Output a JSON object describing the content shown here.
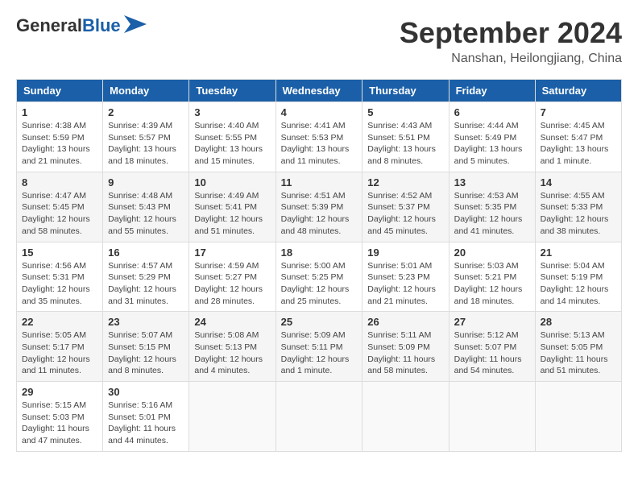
{
  "header": {
    "logo_line1": "General",
    "logo_line2": "Blue",
    "month": "September 2024",
    "location": "Nanshan, Heilongjiang, China"
  },
  "weekdays": [
    "Sunday",
    "Monday",
    "Tuesday",
    "Wednesday",
    "Thursday",
    "Friday",
    "Saturday"
  ],
  "weeks": [
    [
      {
        "day": "1",
        "info": "Sunrise: 4:38 AM\nSunset: 5:59 PM\nDaylight: 13 hours\nand 21 minutes."
      },
      {
        "day": "2",
        "info": "Sunrise: 4:39 AM\nSunset: 5:57 PM\nDaylight: 13 hours\nand 18 minutes."
      },
      {
        "day": "3",
        "info": "Sunrise: 4:40 AM\nSunset: 5:55 PM\nDaylight: 13 hours\nand 15 minutes."
      },
      {
        "day": "4",
        "info": "Sunrise: 4:41 AM\nSunset: 5:53 PM\nDaylight: 13 hours\nand 11 minutes."
      },
      {
        "day": "5",
        "info": "Sunrise: 4:43 AM\nSunset: 5:51 PM\nDaylight: 13 hours\nand 8 minutes."
      },
      {
        "day": "6",
        "info": "Sunrise: 4:44 AM\nSunset: 5:49 PM\nDaylight: 13 hours\nand 5 minutes."
      },
      {
        "day": "7",
        "info": "Sunrise: 4:45 AM\nSunset: 5:47 PM\nDaylight: 13 hours\nand 1 minute."
      }
    ],
    [
      {
        "day": "8",
        "info": "Sunrise: 4:47 AM\nSunset: 5:45 PM\nDaylight: 12 hours\nand 58 minutes."
      },
      {
        "day": "9",
        "info": "Sunrise: 4:48 AM\nSunset: 5:43 PM\nDaylight: 12 hours\nand 55 minutes."
      },
      {
        "day": "10",
        "info": "Sunrise: 4:49 AM\nSunset: 5:41 PM\nDaylight: 12 hours\nand 51 minutes."
      },
      {
        "day": "11",
        "info": "Sunrise: 4:51 AM\nSunset: 5:39 PM\nDaylight: 12 hours\nand 48 minutes."
      },
      {
        "day": "12",
        "info": "Sunrise: 4:52 AM\nSunset: 5:37 PM\nDaylight: 12 hours\nand 45 minutes."
      },
      {
        "day": "13",
        "info": "Sunrise: 4:53 AM\nSunset: 5:35 PM\nDaylight: 12 hours\nand 41 minutes."
      },
      {
        "day": "14",
        "info": "Sunrise: 4:55 AM\nSunset: 5:33 PM\nDaylight: 12 hours\nand 38 minutes."
      }
    ],
    [
      {
        "day": "15",
        "info": "Sunrise: 4:56 AM\nSunset: 5:31 PM\nDaylight: 12 hours\nand 35 minutes."
      },
      {
        "day": "16",
        "info": "Sunrise: 4:57 AM\nSunset: 5:29 PM\nDaylight: 12 hours\nand 31 minutes."
      },
      {
        "day": "17",
        "info": "Sunrise: 4:59 AM\nSunset: 5:27 PM\nDaylight: 12 hours\nand 28 minutes."
      },
      {
        "day": "18",
        "info": "Sunrise: 5:00 AM\nSunset: 5:25 PM\nDaylight: 12 hours\nand 25 minutes."
      },
      {
        "day": "19",
        "info": "Sunrise: 5:01 AM\nSunset: 5:23 PM\nDaylight: 12 hours\nand 21 minutes."
      },
      {
        "day": "20",
        "info": "Sunrise: 5:03 AM\nSunset: 5:21 PM\nDaylight: 12 hours\nand 18 minutes."
      },
      {
        "day": "21",
        "info": "Sunrise: 5:04 AM\nSunset: 5:19 PM\nDaylight: 12 hours\nand 14 minutes."
      }
    ],
    [
      {
        "day": "22",
        "info": "Sunrise: 5:05 AM\nSunset: 5:17 PM\nDaylight: 12 hours\nand 11 minutes."
      },
      {
        "day": "23",
        "info": "Sunrise: 5:07 AM\nSunset: 5:15 PM\nDaylight: 12 hours\nand 8 minutes."
      },
      {
        "day": "24",
        "info": "Sunrise: 5:08 AM\nSunset: 5:13 PM\nDaylight: 12 hours\nand 4 minutes."
      },
      {
        "day": "25",
        "info": "Sunrise: 5:09 AM\nSunset: 5:11 PM\nDaylight: 12 hours\nand 1 minute."
      },
      {
        "day": "26",
        "info": "Sunrise: 5:11 AM\nSunset: 5:09 PM\nDaylight: 11 hours\nand 58 minutes."
      },
      {
        "day": "27",
        "info": "Sunrise: 5:12 AM\nSunset: 5:07 PM\nDaylight: 11 hours\nand 54 minutes."
      },
      {
        "day": "28",
        "info": "Sunrise: 5:13 AM\nSunset: 5:05 PM\nDaylight: 11 hours\nand 51 minutes."
      }
    ],
    [
      {
        "day": "29",
        "info": "Sunrise: 5:15 AM\nSunset: 5:03 PM\nDaylight: 11 hours\nand 47 minutes."
      },
      {
        "day": "30",
        "info": "Sunrise: 5:16 AM\nSunset: 5:01 PM\nDaylight: 11 hours\nand 44 minutes."
      },
      {
        "day": "",
        "info": ""
      },
      {
        "day": "",
        "info": ""
      },
      {
        "day": "",
        "info": ""
      },
      {
        "day": "",
        "info": ""
      },
      {
        "day": "",
        "info": ""
      }
    ]
  ]
}
